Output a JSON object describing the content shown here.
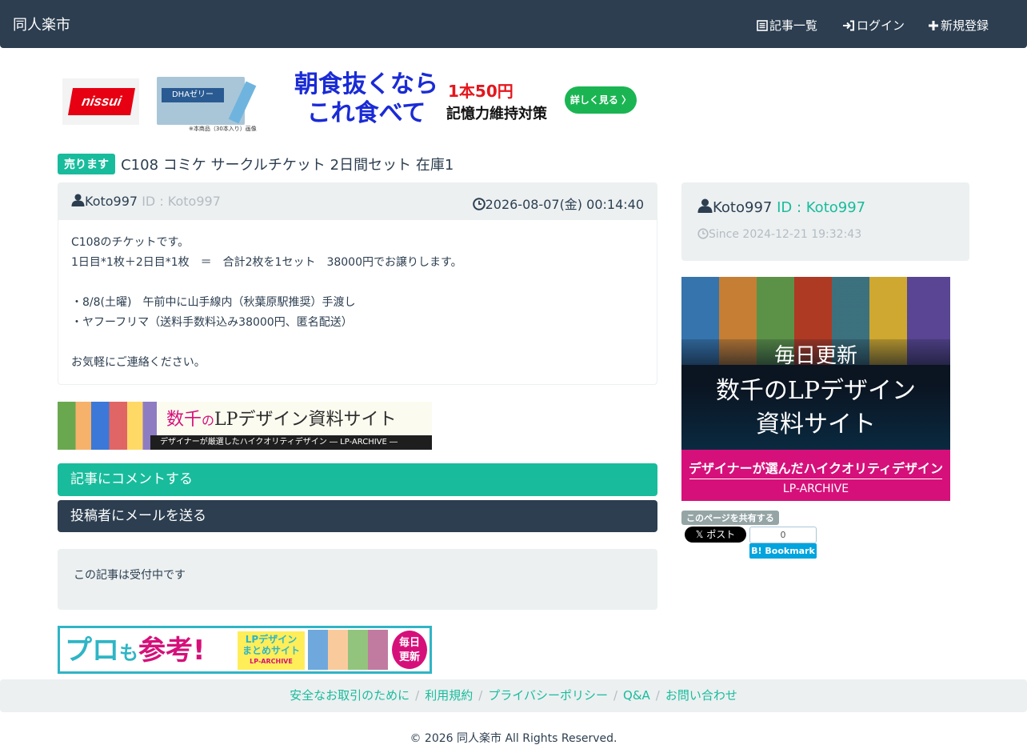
{
  "navbar": {
    "brand": "同人楽市",
    "items": [
      {
        "label": "記事一覧",
        "icon": "list-icon"
      },
      {
        "label": "ログイン",
        "icon": "login-icon"
      },
      {
        "label": "新規登録",
        "icon": "plus-icon"
      }
    ]
  },
  "top_ad": {
    "logo_text": "nissui",
    "product_label": "DHAゼリー",
    "headline": "朝食抜くなら これ食べて",
    "price": "1本50円",
    "subline": "記憶力維持対策",
    "button": "詳しく見る 〉",
    "note": "※本商品（30本入り）画像"
  },
  "post": {
    "badge": "売ります",
    "title": "C108 コミケ サークルチケット 2日間セット 在庫1",
    "user_name": "Koto997",
    "user_id": "ID : Koto997",
    "date": "2026-08-07(金) 00:14:40",
    "body_lines": [
      "C108のチケットです。",
      "1日目*1枚＋2日目*1枚　＝　合計2枚を1セット　38000円でお譲りします。",
      "",
      "・8/8(土曜)　午前中に山手線内（秋葉原駅推奨）手渡し",
      "・ヤフーフリマ（送料手数料込み38000円、匿名配送）",
      "",
      "お気軽にご連絡ください。"
    ]
  },
  "lp_banner1": {
    "title_pre": "数千",
    "title_mid": "の",
    "title_post": "LPデザイン資料サイト",
    "strip": "デザイナーが厳選したハイクオリティデザイン ― LP-ARCHIVE ―"
  },
  "buttons": {
    "comment": "記事にコメントする",
    "mail": "投稿者にメールを送る"
  },
  "status_text": "この記事は受付中です",
  "lp_banner2": {
    "pro": "プロ",
    "mo": "も",
    "sankou": "参考!",
    "tag_line1": "LPデザイン",
    "tag_line2": "まとめサイト",
    "tag_sub": "LP-ARCHIVE",
    "circle_line1": "毎日",
    "circle_line2": "更新"
  },
  "sidebar": {
    "user_name": "Koto997",
    "user_id": "ID : Koto997",
    "since": "Since 2024-12-21 19:32:43",
    "ad": {
      "line1": "毎日更新",
      "line2": "数千のLPデザイン",
      "line3": "資料サイト",
      "bottom1": "デザイナーが選んだハイクオリティデザイン",
      "bottom2": "LP-ARCHIVE"
    },
    "share_label": "このページを共有する",
    "x_post": "𝕏 ポスト",
    "hatena_count": "0",
    "hatena_label": "B! Bookmark"
  },
  "footer": {
    "links": [
      "安全なお取引のために",
      "利用規約",
      "プライバシーポリシー",
      "Q&A",
      "お問い合わせ"
    ],
    "copyright": "© 2026 同人楽市 All Rights Reserved."
  },
  "colors": {
    "navbar": "#2c3e50",
    "accent": "#18bc9c",
    "panel_bg": "#ecf0f1",
    "muted": "#b4bcc2"
  }
}
